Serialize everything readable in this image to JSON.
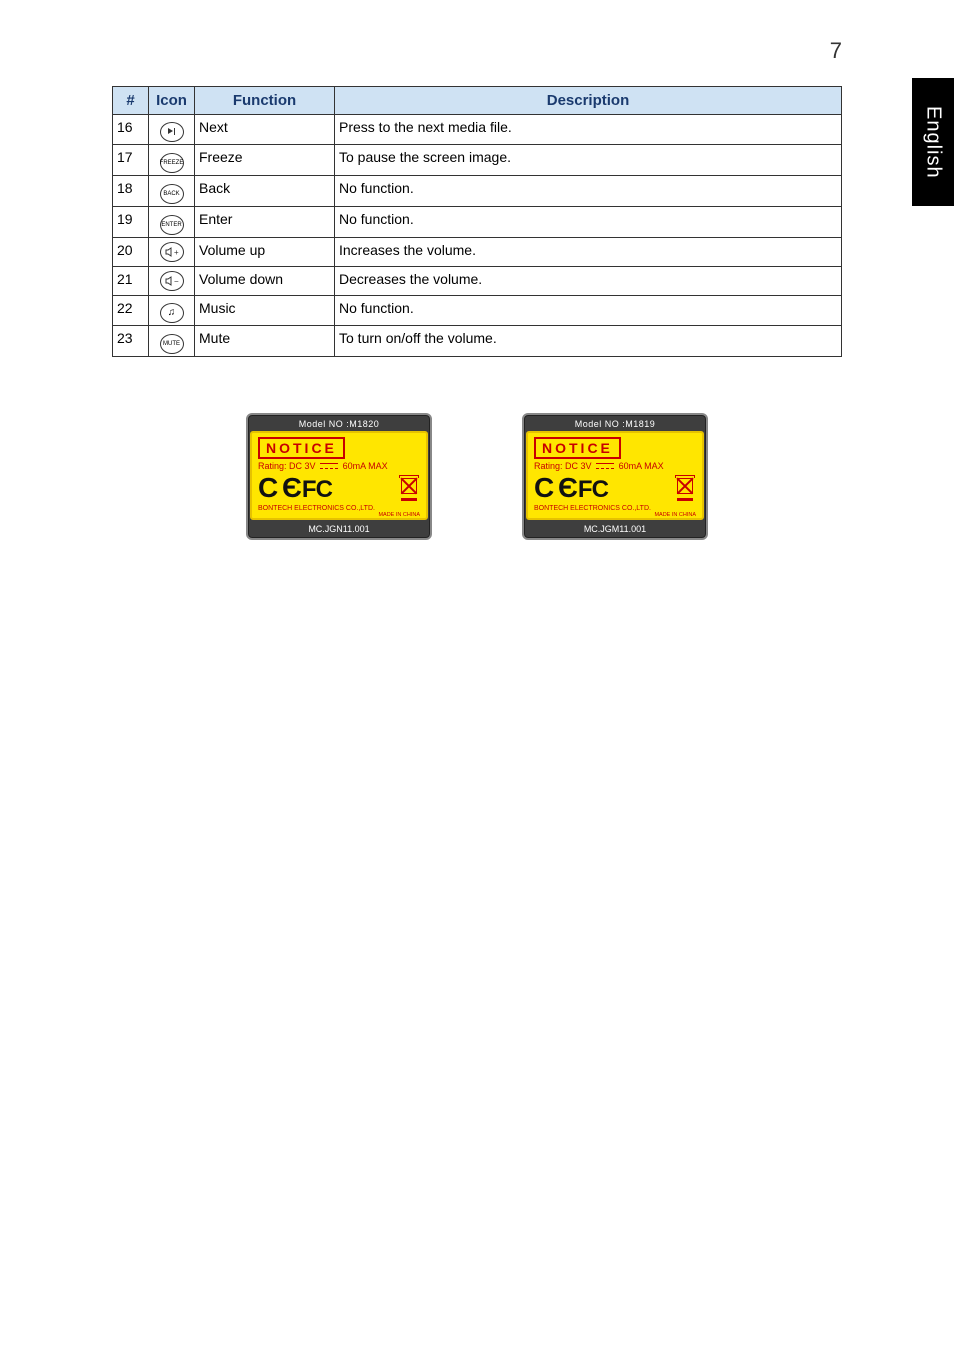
{
  "page_number": "7",
  "side_tab": "English",
  "table": {
    "headers": {
      "num": "#",
      "icon": "Icon",
      "func": "Function",
      "desc": "Description"
    },
    "rows": [
      {
        "num": "16",
        "icon": "next-icon",
        "func": "Next",
        "desc": "Press to the next media file."
      },
      {
        "num": "17",
        "icon": "freeze-icon",
        "icon_label": "FREEZE",
        "func": "Freeze",
        "desc": "To pause the screen image."
      },
      {
        "num": "18",
        "icon": "back-icon",
        "icon_label": "BACK",
        "func": "Back",
        "desc": "No function."
      },
      {
        "num": "19",
        "icon": "enter-icon",
        "icon_label": "ENTER",
        "func": "Enter",
        "desc": "No function."
      },
      {
        "num": "20",
        "icon": "vol-up-icon",
        "icon_label": "🔊+",
        "func": "Volume up",
        "desc": "Increases the volume."
      },
      {
        "num": "21",
        "icon": "vol-down-icon",
        "icon_label": "🔊−",
        "func": "Volume down",
        "desc": "Decreases the volume."
      },
      {
        "num": "22",
        "icon": "music-icon",
        "icon_label": "♫",
        "func": "Music",
        "desc": "No function."
      },
      {
        "num": "23",
        "icon": "mute-icon",
        "icon_label": "MUTE",
        "func": "Mute",
        "desc": "To turn on/off the volume."
      }
    ]
  },
  "labels": [
    {
      "model": "Model NO :M1820",
      "notice": "NOTICE",
      "rating_pre": "Rating: DC 3V",
      "rating_post": "60mA MAX",
      "ce": "C Є",
      "fc": "FC",
      "mfr": "BONTECH ELECTRONICS CO.,LTD.",
      "made": "MADE IN CHINA",
      "code": "MC.JGN11.001"
    },
    {
      "model": "Model NO :M1819",
      "notice": "NOTICE",
      "rating_pre": "Rating: DC 3V",
      "rating_post": "60mA MAX",
      "ce": "C Є",
      "fc": "FC",
      "mfr": "BONTECH ELECTRONICS CO.,LTD.",
      "made": "MADE IN CHINA",
      "code": "MC.JGM11.001"
    }
  ]
}
